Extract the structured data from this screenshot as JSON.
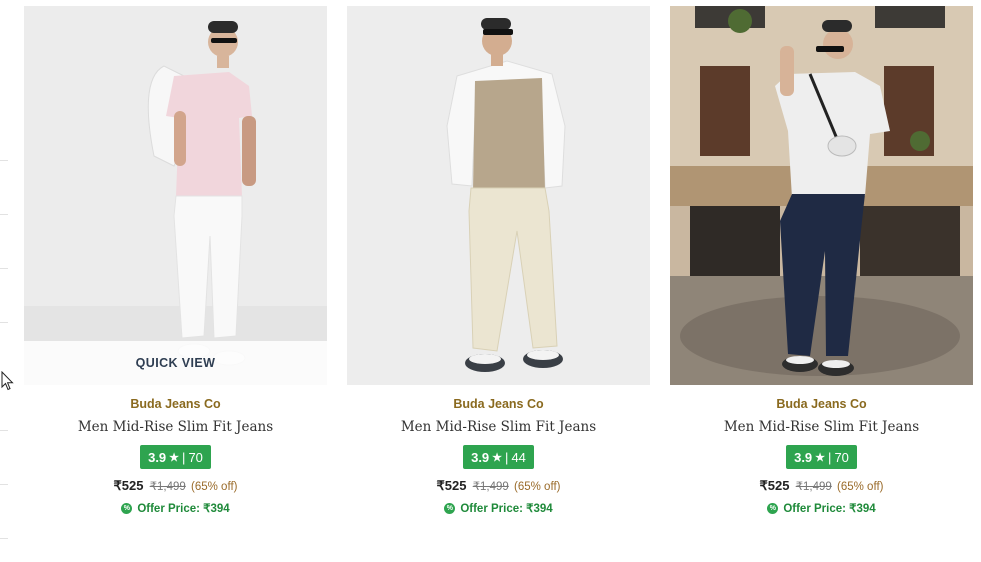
{
  "products": [
    {
      "brand": "Buda Jeans Co",
      "title": "Men Mid-Rise Slim Fit Jeans",
      "rating": "3.9",
      "rating_count": "70",
      "price": "₹525",
      "mrp": "₹1,499",
      "discount": "(65% off)",
      "offer_price": "Offer Price: ₹394",
      "quick_view": "QUICK VIEW"
    },
    {
      "brand": "Buda Jeans Co",
      "title": "Men Mid-Rise Slim Fit Jeans",
      "rating": "3.9",
      "rating_count": "44",
      "price": "₹525",
      "mrp": "₹1,499",
      "discount": "(65% off)",
      "offer_price": "Offer Price: ₹394"
    },
    {
      "brand": "Buda Jeans Co",
      "title": "Men Mid-Rise Slim Fit Jeans",
      "rating": "3.9",
      "rating_count": "70",
      "price": "₹525",
      "mrp": "₹1,499",
      "discount": "(65% off)",
      "offer_price": "Offer Price: ₹394"
    }
  ],
  "colors": {
    "brand_text": "#8a6a1f",
    "rating_badge": "#2ea44f",
    "offer_text": "#1f8a3a"
  },
  "icons": {
    "rating": "star-icon",
    "offer": "percent-offer-icon",
    "cursor": "mouse-cursor-icon"
  }
}
